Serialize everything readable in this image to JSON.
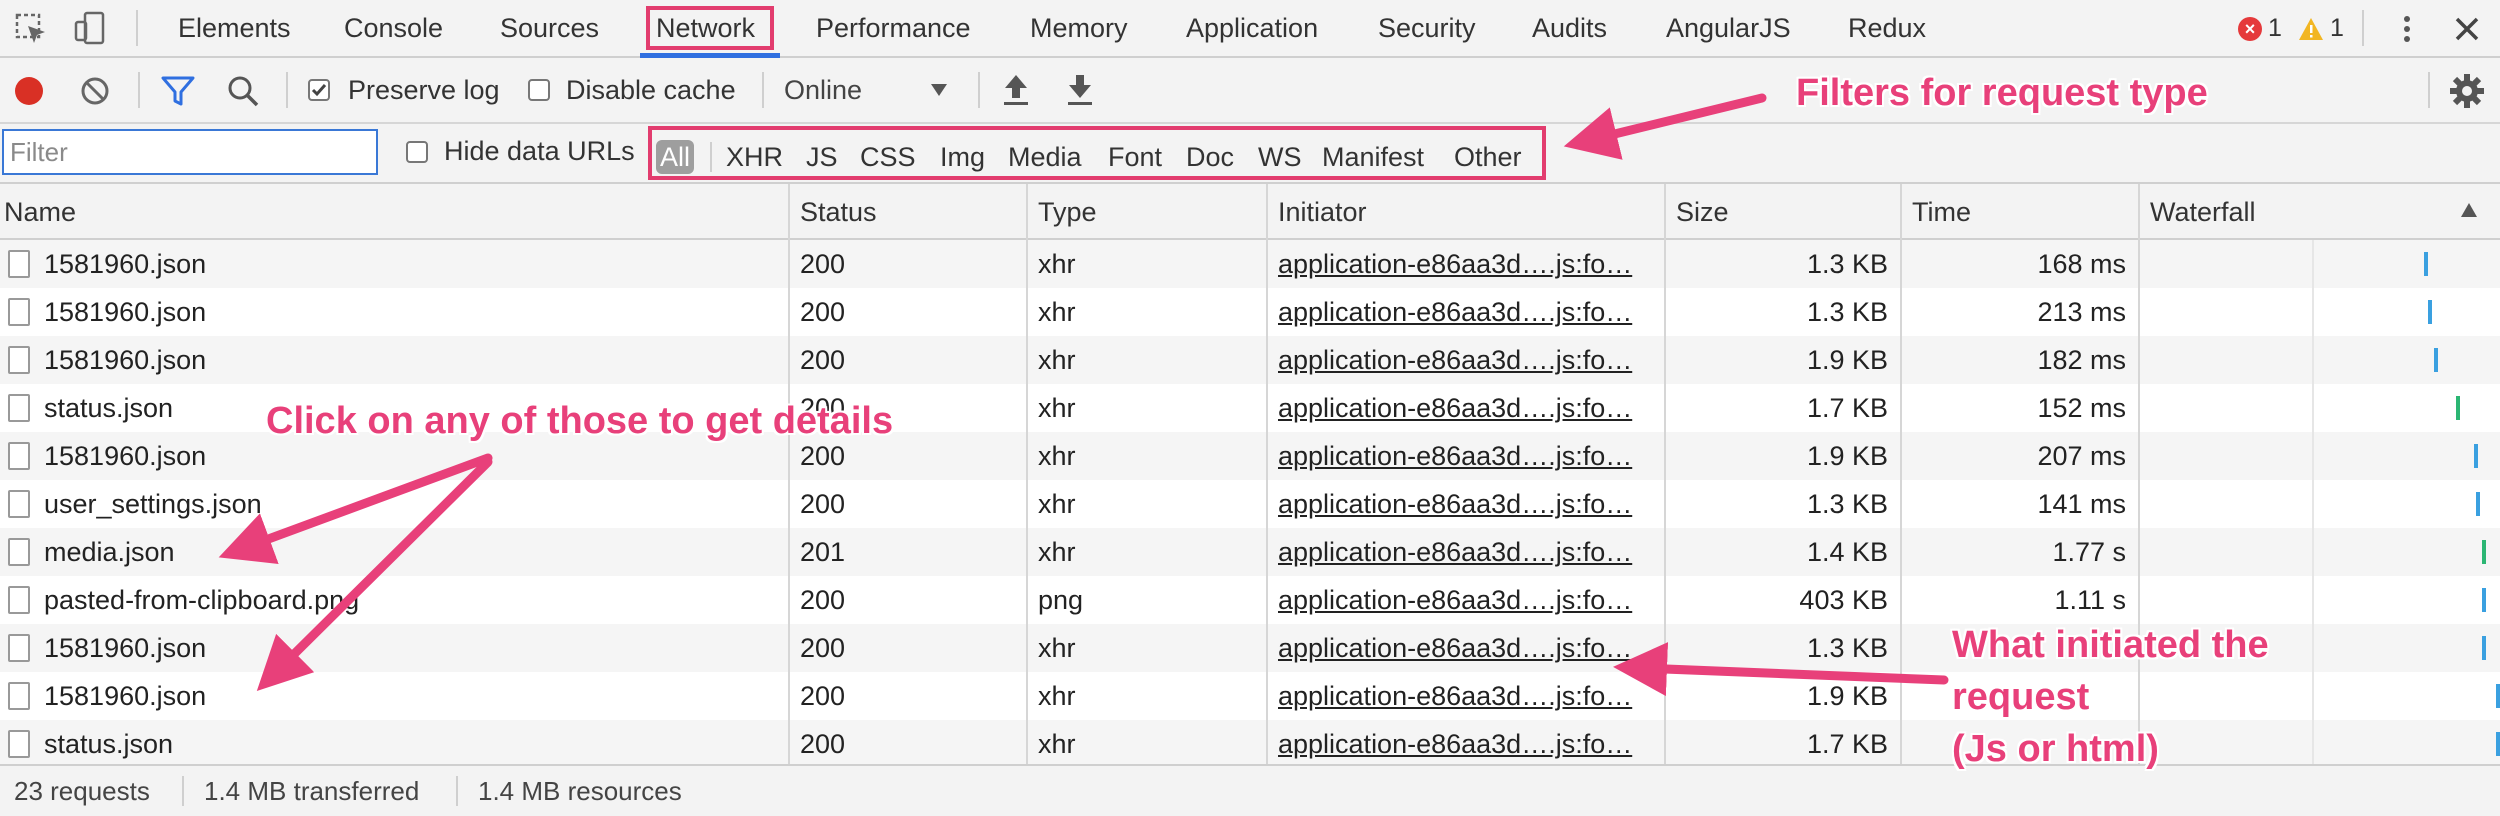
{
  "tabs": [
    {
      "label": "Elements"
    },
    {
      "label": "Console"
    },
    {
      "label": "Sources"
    },
    {
      "label": "Network",
      "active": true
    },
    {
      "label": "Performance"
    },
    {
      "label": "Memory"
    },
    {
      "label": "Application"
    },
    {
      "label": "Security"
    },
    {
      "label": "Audits"
    },
    {
      "label": "AngularJS"
    },
    {
      "label": "Redux"
    }
  ],
  "counters": {
    "errors": "1",
    "warnings": "1"
  },
  "toolbar": {
    "preserve_log": "Preserve log",
    "preserve_log_checked": true,
    "disable_cache": "Disable cache",
    "disable_cache_checked": false,
    "throttle": "Online"
  },
  "filter": {
    "placeholder": "Filter",
    "hide_data_urls": "Hide data URLs",
    "types": [
      "All",
      "XHR",
      "JS",
      "CSS",
      "Img",
      "Media",
      "Font",
      "Doc",
      "WS",
      "Manifest",
      "Other"
    ],
    "active_type": "All"
  },
  "columns": {
    "name": "Name",
    "status": "Status",
    "type": "Type",
    "initiator": "Initiator",
    "size": "Size",
    "time": "Time",
    "waterfall": "Waterfall"
  },
  "rows": [
    {
      "name": "1581960.json",
      "status": "200",
      "type": "xhr",
      "initiator": "application-e86aa3d….js:fo…",
      "size": "1.3 KB",
      "time": "168 ms"
    },
    {
      "name": "1581960.json",
      "status": "200",
      "type": "xhr",
      "initiator": "application-e86aa3d….js:fo…",
      "size": "1.3 KB",
      "time": "213 ms"
    },
    {
      "name": "1581960.json",
      "status": "200",
      "type": "xhr",
      "initiator": "application-e86aa3d….js:fo…",
      "size": "1.9 KB",
      "time": "182 ms"
    },
    {
      "name": "status.json",
      "status": "200",
      "type": "xhr",
      "initiator": "application-e86aa3d….js:fo…",
      "size": "1.7 KB",
      "time": "152 ms"
    },
    {
      "name": "1581960.json",
      "status": "200",
      "type": "xhr",
      "initiator": "application-e86aa3d….js:fo…",
      "size": "1.9 KB",
      "time": "207 ms"
    },
    {
      "name": "user_settings.json",
      "status": "200",
      "type": "xhr",
      "initiator": "application-e86aa3d….js:fo…",
      "size": "1.3 KB",
      "time": "141 ms"
    },
    {
      "name": "media.json",
      "status": "201",
      "type": "xhr",
      "initiator": "application-e86aa3d….js:fo…",
      "size": "1.4 KB",
      "time": "1.77 s"
    },
    {
      "name": "pasted-from-clipboard.png",
      "status": "200",
      "type": "png",
      "initiator": "application-e86aa3d….js:fo…",
      "size": "403 KB",
      "time": "1.11 s"
    },
    {
      "name": "1581960.json",
      "status": "200",
      "type": "xhr",
      "initiator": "application-e86aa3d….js:fo…",
      "size": "1.3 KB",
      "time": ""
    },
    {
      "name": "1581960.json",
      "status": "200",
      "type": "xhr",
      "initiator": "application-e86aa3d….js:fo…",
      "size": "1.9 KB",
      "time": ""
    },
    {
      "name": "status.json",
      "status": "200",
      "type": "xhr",
      "initiator": "application-e86aa3d….js:fo…",
      "size": "1.7 KB",
      "time": ""
    }
  ],
  "status_bar": {
    "requests": "23 requests",
    "transferred": "1.4 MB transferred",
    "resources": "1.4 MB resources"
  },
  "annotations": {
    "filters": "Filters for request type",
    "click": "Click on any of those to get details",
    "initiator_line1": "What initiated the",
    "initiator_line2": "request",
    "initiator_line3": "(Js or html)"
  },
  "colors": {
    "annotation": "#e8407a",
    "record": "#d93025",
    "accent": "#2f6fe0",
    "waterfall_blue": "#3aa0e0",
    "waterfall_green": "#2bb673"
  },
  "icons": [
    "inspect-icon",
    "device-icon",
    "record-icon",
    "clear-icon",
    "filter-icon",
    "search-icon",
    "import-icon",
    "export-icon",
    "more-icon",
    "close-icon",
    "gear-icon",
    "sort-up-icon",
    "file-icon"
  ]
}
